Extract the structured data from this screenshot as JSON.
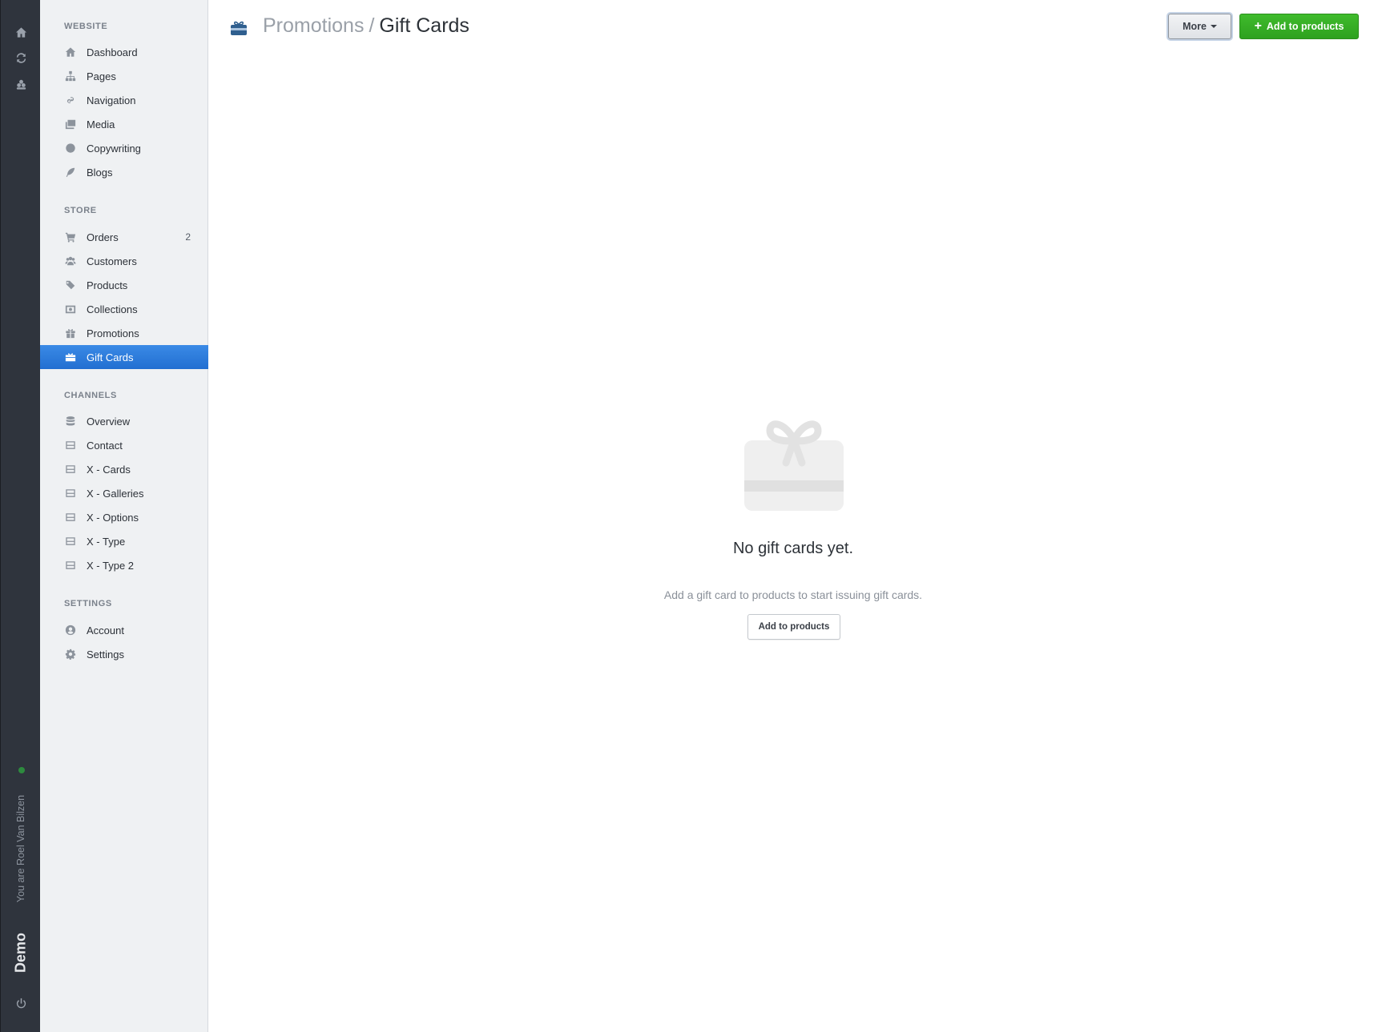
{
  "rail": {
    "user_text": "You are Roel Van Bilzen",
    "brand": "Demo",
    "icons": [
      "home-icon",
      "refresh-icon",
      "users-icon",
      "power-icon"
    ],
    "status_color": "#2d8a3e"
  },
  "sidebar": {
    "sections": {
      "website": "WEBSITE",
      "store": "STORE",
      "channels": "CHANNELS",
      "settings": "SETTINGS"
    },
    "website_items": [
      "Dashboard",
      "Pages",
      "Navigation",
      "Media",
      "Copywriting",
      "Blogs"
    ],
    "store_items": [
      "Orders",
      "Customers",
      "Products",
      "Collections",
      "Promotions",
      "Gift Cards"
    ],
    "orders_count": "2",
    "channel_items": [
      "Overview",
      "Contact",
      "X - Cards",
      "X - Galleries",
      "X - Options",
      "X - Type",
      "X - Type 2"
    ],
    "settings_items": [
      "Account",
      "Settings"
    ],
    "active_item": "Gift Cards",
    "active_color": "#2a7ee0"
  },
  "header": {
    "breadcrumb_parent": "Promotions",
    "separator": "/",
    "title": "Gift Cards",
    "more_label": "More",
    "add_label": "Add to products",
    "add_color": "#35ad25"
  },
  "empty_state": {
    "title": "No gift cards yet.",
    "subtitle": "Add a gift card to products to start issuing gift cards.",
    "button_label": "Add to products"
  }
}
